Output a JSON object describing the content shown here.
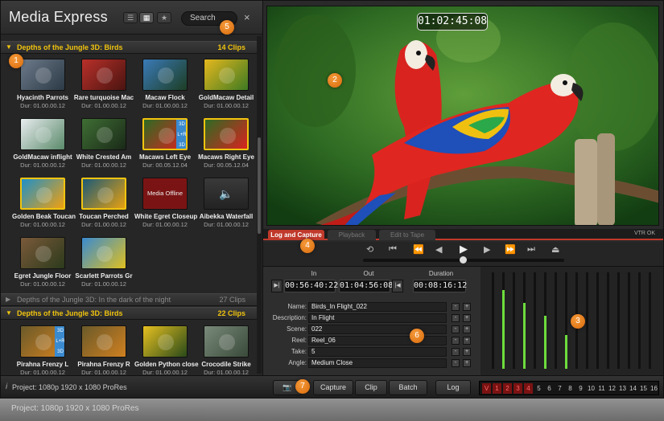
{
  "app": {
    "title": "Media Express"
  },
  "header": {
    "search_label": "Search",
    "close_glyph": "×"
  },
  "bins": [
    {
      "name": "Depths of the Jungle 3D: Birds",
      "count": "14 Clips"
    },
    {
      "name": "Depths of the Jungle 3D: In the dark of the night",
      "count": "27 Clips"
    },
    {
      "name": "Depths of the Jungle 3D: Birds",
      "count": "22 Clips"
    }
  ],
  "clips": [
    {
      "name": "Hyacinth Parrots",
      "dur": "Dur: 01.00.00.12"
    },
    {
      "name": "Rare turquoise Mac",
      "dur": "Dur: 01.00.00.12"
    },
    {
      "name": "Macaw Flock",
      "dur": "Dur: 01.00.00.12"
    },
    {
      "name": "GoldMacaw Detail",
      "dur": "Dur: 01.00.00.12"
    },
    {
      "name": "GoldMacaw inflight",
      "dur": "Dur: 01.00.00.12"
    },
    {
      "name": "White Crested Am",
      "dur": "Dur: 01.00.00.12"
    },
    {
      "name": "Macaws Left Eye",
      "dur": "Dur: 00.05.12.04"
    },
    {
      "name": "Macaws Right Eye",
      "dur": "Dur: 00.05.12.04"
    },
    {
      "name": "Golden Beak Toucan",
      "dur": "Dur: 01.00.00.12"
    },
    {
      "name": "Toucan Perched",
      "dur": "Dur: 01.00.00.12"
    },
    {
      "name": "White Egret Closeup",
      "dur": "Dur: 01.00.00.12"
    },
    {
      "name": "Aibekka Waterfall",
      "dur": "Dur: 01.00.00.12"
    },
    {
      "name": "Egret Jungle Floor",
      "dur": "Dur: 01.00.00.12"
    },
    {
      "name": "Scarlett Parrots Gr",
      "dur": "Dur: 01.00.00.12"
    },
    {
      "name": "Pirahna Frenzy L",
      "dur": "Dur: 01.00.00.12"
    },
    {
      "name": "Pirahna Frenzy R",
      "dur": "Dur: 01.00.00.12"
    },
    {
      "name": "Golden Python close",
      "dur": "Dur: 01.00.00.12"
    },
    {
      "name": "Crocodile Strike",
      "dur": "Dur: 01.00.00.12"
    }
  ],
  "thumb_labels": {
    "media_offline": "Media Offline",
    "badge_3d": "3D",
    "badge_lr": "L+R"
  },
  "viewer": {
    "timecode": "01:02:45:08"
  },
  "tabs": {
    "log": "Log and Capture",
    "playback": "Playback",
    "edit": "Edit to Tape",
    "vtr": "VTR OK"
  },
  "transport_icons": [
    "loop-icon",
    "skip-start-icon",
    "rewind-icon",
    "step-back-icon",
    "play-icon",
    "step-forward-icon",
    "fast-forward-icon",
    "skip-end-icon",
    "eject-icon"
  ],
  "capture": {
    "in_label": "In",
    "out_label": "Out",
    "duration_label": "Duration",
    "in_tc": "00:56:40:22",
    "out_tc": "01:04:56:08",
    "duration_tc": "00:08:16:12"
  },
  "metadata": [
    {
      "label": "Name:",
      "value": "Birds_In Flight_022"
    },
    {
      "label": "Description:",
      "value": "In Flight"
    },
    {
      "label": "Scene:",
      "value": "022"
    },
    {
      "label": "Reel:",
      "value": "Reel_06"
    },
    {
      "label": "Take:",
      "value": "5"
    },
    {
      "label": "Angle:",
      "value": "Medium Close"
    }
  ],
  "audio_levels": [
    0,
    0.82,
    0,
    0.68,
    0,
    0.55,
    0,
    0.35,
    0,
    0,
    0,
    0,
    0,
    0,
    0,
    0
  ],
  "bottom": {
    "project": "Project: 1080p 1920 x 1080 ProRes",
    "capture": "Capture",
    "clip": "Clip",
    "batch": "Batch",
    "log": "Log",
    "channels": [
      "V",
      "1",
      "2",
      "3",
      "4",
      "5",
      "6",
      "7",
      "8",
      "9",
      "10",
      "11",
      "12",
      "13",
      "14",
      "15",
      "16"
    ]
  },
  "callouts": [
    "1",
    "2",
    "3",
    "4",
    "5",
    "6",
    "7"
  ],
  "colors": {
    "accent": "#c0392b",
    "highlight": "#f1c40f",
    "meter": "#6ddc3c",
    "callout": "#e67e22"
  }
}
